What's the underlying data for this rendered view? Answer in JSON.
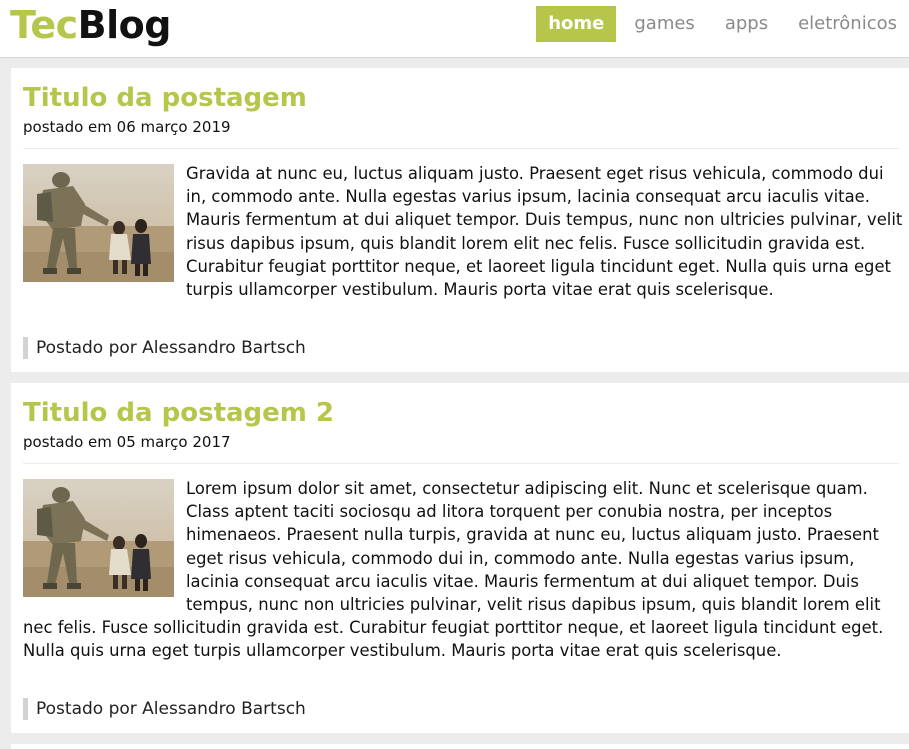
{
  "site": {
    "logo_part1": "Tec",
    "logo_part2": "Blog",
    "accent_color": "#b5c64a"
  },
  "nav": {
    "items": [
      {
        "label": "home",
        "active": true
      },
      {
        "label": "games",
        "active": false
      },
      {
        "label": "apps",
        "active": false
      },
      {
        "label": "eletrônicos",
        "active": false
      }
    ]
  },
  "posts": [
    {
      "title": "Titulo da postagem",
      "date": "postado em 06 março 2019",
      "body": "Gravida at nunc eu, luctus aliquam justo. Praesent eget risus vehicula, commodo dui in, commodo ante. Nulla egestas varius ipsum, lacinia consequat arcu iaculis vitae. Mauris fermentum at dui aliquet tempor. Duis tempus, nunc non ultricies pulvinar, velit risus dapibus ipsum, quis blandit lorem elit nec felis. Fusce sollicitudin gravida est. Curabitur feugiat porttitor neque, et laoreet ligula tincidunt eget. Nulla quis urna eget turpis ullamcorper vestibulum. Mauris porta vitae erat quis scelerisque.",
      "author": "Postado por Alessandro Bartsch",
      "image": "soldier-with-child-photo"
    },
    {
      "title": "Titulo da postagem 2",
      "date": "postado em 05 março 2017",
      "body": "Lorem ipsum dolor sit amet, consectetur adipiscing elit. Nunc et scelerisque quam. Class aptent taciti sociosqu ad litora torquent per conubia nostra, per inceptos himenaeos. Praesent nulla turpis, gravida at nunc eu, luctus aliquam justo. Praesent eget risus vehicula, commodo dui in, commodo ante. Nulla egestas varius ipsum, lacinia consequat arcu iaculis vitae. Mauris fermentum at dui aliquet tempor. Duis tempus, nunc non ultricies pulvinar, velit risus dapibus ipsum, quis blandit lorem elit nec felis. Fusce sollicitudin gravida est. Curabitur feugiat porttitor neque, et laoreet ligula tincidunt eget. Nulla quis urna eget turpis ullamcorper vestibulum. Mauris porta vitae erat quis scelerisque.",
      "author": "Postado por Alessandro Bartsch",
      "image": "soldier-with-child-photo"
    }
  ]
}
